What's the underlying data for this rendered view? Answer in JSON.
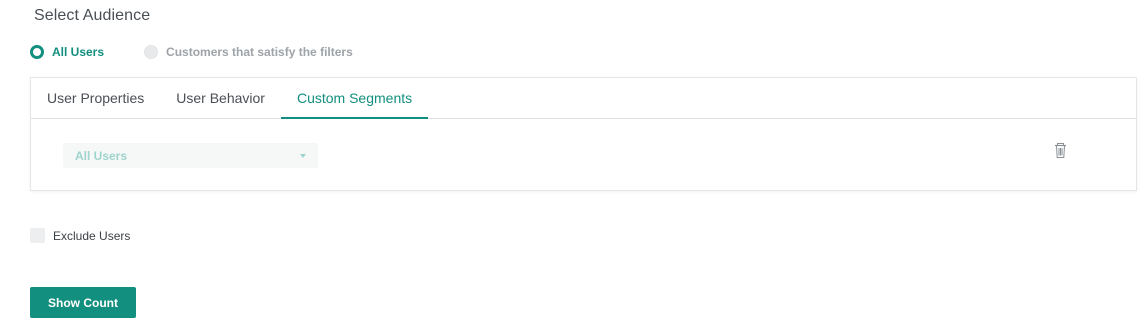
{
  "audience": {
    "title": "Select Audience",
    "options": [
      {
        "label": "All Users",
        "selected": true
      },
      {
        "label": "Customers that satisfy the filters",
        "selected": false
      }
    ]
  },
  "tabs": [
    {
      "label": "User Properties",
      "active": false
    },
    {
      "label": "User Behavior",
      "active": false
    },
    {
      "label": "Custom Segments",
      "active": true
    }
  ],
  "segment": {
    "dropdown_value": "All Users",
    "delete_icon": "trash-icon"
  },
  "exclude": {
    "label": "Exclude Users",
    "checked": false
  },
  "actions": {
    "show_count_label": "Show Count"
  },
  "colors": {
    "accent": "#128f7e",
    "muted_accent": "#9fd4cc",
    "text": "#4a4f55"
  }
}
